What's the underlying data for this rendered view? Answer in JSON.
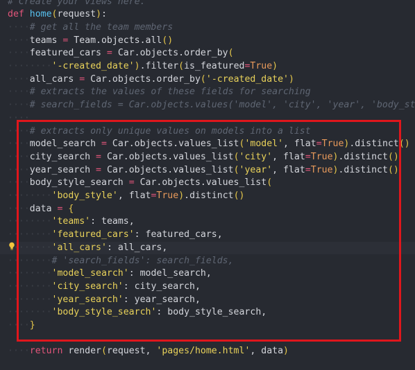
{
  "colors": {
    "background": "#272a31",
    "highlight_box": "#e0161c",
    "comment": "#5f6673",
    "keyword": "#e2557a",
    "function": "#58c2f0",
    "string": "#e9d25a",
    "bool": "#e89a5b",
    "paren": "#e5c64a",
    "text": "#d4d6dc"
  },
  "icons": {
    "gutter_hint": "lightbulb-icon"
  },
  "code": {
    "lines": [
      {
        "tokens": [
          {
            "t": "comment",
            "v": "# Create your views here."
          }
        ]
      },
      {
        "tokens": [
          {
            "t": "keyword",
            "v": "def"
          },
          {
            "t": "ident",
            "v": " "
          },
          {
            "t": "func",
            "v": "home"
          },
          {
            "t": "paren",
            "v": "("
          },
          {
            "t": "ident",
            "v": "request"
          },
          {
            "t": "paren",
            "v": ")"
          },
          {
            "t": "punct",
            "v": ":"
          }
        ]
      },
      {
        "tokens": [
          {
            "t": "ws",
            "v": "····"
          },
          {
            "t": "comment",
            "v": "# get all the team members"
          }
        ]
      },
      {
        "tokens": [
          {
            "t": "ws",
            "v": "····"
          },
          {
            "t": "ident",
            "v": "teams "
          },
          {
            "t": "operator",
            "v": "="
          },
          {
            "t": "ident",
            "v": " Team.objects.all"
          },
          {
            "t": "paren",
            "v": "()"
          }
        ]
      },
      {
        "tokens": [
          {
            "t": "ws",
            "v": "····"
          },
          {
            "t": "ident",
            "v": "featured_cars "
          },
          {
            "t": "operator",
            "v": "="
          },
          {
            "t": "ident",
            "v": " Car.objects.order_by"
          },
          {
            "t": "paren",
            "v": "("
          }
        ]
      },
      {
        "tokens": [
          {
            "t": "ws",
            "v": "········"
          },
          {
            "t": "string",
            "v": "'-created_date'"
          },
          {
            "t": "paren",
            "v": ")"
          },
          {
            "t": "ident",
            "v": ".filter"
          },
          {
            "t": "paren",
            "v": "("
          },
          {
            "t": "param",
            "v": "is_featured"
          },
          {
            "t": "operator",
            "v": "="
          },
          {
            "t": "bool",
            "v": "True"
          },
          {
            "t": "paren",
            "v": ")"
          }
        ]
      },
      {
        "tokens": [
          {
            "t": "ws",
            "v": "····"
          },
          {
            "t": "ident",
            "v": "all_cars "
          },
          {
            "t": "operator",
            "v": "="
          },
          {
            "t": "ident",
            "v": " Car.objects.order_by"
          },
          {
            "t": "paren",
            "v": "("
          },
          {
            "t": "string",
            "v": "'-created_date'"
          },
          {
            "t": "paren",
            "v": ")"
          }
        ]
      },
      {
        "tokens": [
          {
            "t": "ws",
            "v": "····"
          },
          {
            "t": "comment",
            "v": "# extracts the values of these fields for searching"
          }
        ]
      },
      {
        "tokens": [
          {
            "t": "ws",
            "v": "····"
          },
          {
            "t": "comment",
            "v": "# search_fields = Car.objects.values('model', 'city', 'year', 'body_style'"
          }
        ]
      },
      {
        "tokens": [
          {
            "t": "ws",
            "v": "····"
          }
        ]
      },
      {
        "tokens": [
          {
            "t": "ws",
            "v": "····"
          },
          {
            "t": "comment",
            "v": "# extracts only unique values on models into a list"
          }
        ]
      },
      {
        "tokens": [
          {
            "t": "ws",
            "v": "····"
          },
          {
            "t": "ident",
            "v": "model_search "
          },
          {
            "t": "operator",
            "v": "="
          },
          {
            "t": "ident",
            "v": " Car.objects.values_list"
          },
          {
            "t": "paren",
            "v": "("
          },
          {
            "t": "string",
            "v": "'model'"
          },
          {
            "t": "punct",
            "v": ", "
          },
          {
            "t": "param",
            "v": "flat"
          },
          {
            "t": "operator",
            "v": "="
          },
          {
            "t": "bool",
            "v": "True"
          },
          {
            "t": "paren",
            "v": ")"
          },
          {
            "t": "ident",
            "v": ".distinct"
          },
          {
            "t": "paren",
            "v": "()"
          }
        ]
      },
      {
        "tokens": [
          {
            "t": "ws",
            "v": "····"
          },
          {
            "t": "ident",
            "v": "city_search "
          },
          {
            "t": "operator",
            "v": "="
          },
          {
            "t": "ident",
            "v": " Car.objects.values_list"
          },
          {
            "t": "paren",
            "v": "("
          },
          {
            "t": "string",
            "v": "'city'"
          },
          {
            "t": "punct",
            "v": ", "
          },
          {
            "t": "param",
            "v": "flat"
          },
          {
            "t": "operator",
            "v": "="
          },
          {
            "t": "bool",
            "v": "True"
          },
          {
            "t": "paren",
            "v": ")"
          },
          {
            "t": "ident",
            "v": ".distinct"
          },
          {
            "t": "paren",
            "v": "()"
          }
        ]
      },
      {
        "tokens": [
          {
            "t": "ws",
            "v": "····"
          },
          {
            "t": "ident",
            "v": "year_search "
          },
          {
            "t": "operator",
            "v": "="
          },
          {
            "t": "ident",
            "v": " Car.objects.values_list"
          },
          {
            "t": "paren",
            "v": "("
          },
          {
            "t": "string",
            "v": "'year'"
          },
          {
            "t": "punct",
            "v": ", "
          },
          {
            "t": "param",
            "v": "flat"
          },
          {
            "t": "operator",
            "v": "="
          },
          {
            "t": "bool",
            "v": "True"
          },
          {
            "t": "paren",
            "v": ")"
          },
          {
            "t": "ident",
            "v": ".distinct"
          },
          {
            "t": "paren",
            "v": "()"
          }
        ]
      },
      {
        "tokens": [
          {
            "t": "ws",
            "v": "····"
          },
          {
            "t": "ident",
            "v": "body_style_search "
          },
          {
            "t": "operator",
            "v": "="
          },
          {
            "t": "ident",
            "v": " Car.objects.values_list"
          },
          {
            "t": "paren",
            "v": "("
          }
        ]
      },
      {
        "tokens": [
          {
            "t": "ws",
            "v": "········"
          },
          {
            "t": "string",
            "v": "'body_style'"
          },
          {
            "t": "punct",
            "v": ", "
          },
          {
            "t": "param",
            "v": "flat"
          },
          {
            "t": "operator",
            "v": "="
          },
          {
            "t": "bool",
            "v": "True"
          },
          {
            "t": "paren",
            "v": ")"
          },
          {
            "t": "ident",
            "v": ".distinct"
          },
          {
            "t": "paren",
            "v": "()"
          }
        ]
      },
      {
        "tokens": [
          {
            "t": "ws",
            "v": "····"
          },
          {
            "t": "ident",
            "v": "data "
          },
          {
            "t": "operator",
            "v": "="
          },
          {
            "t": "ident",
            "v": " "
          },
          {
            "t": "brace",
            "v": "{"
          }
        ]
      },
      {
        "tokens": [
          {
            "t": "ws",
            "v": "········"
          },
          {
            "t": "string",
            "v": "'teams'"
          },
          {
            "t": "punct",
            "v": ": "
          },
          {
            "t": "ident",
            "v": "teams,"
          }
        ]
      },
      {
        "tokens": [
          {
            "t": "ws",
            "v": "········"
          },
          {
            "t": "string",
            "v": "'featured_cars'"
          },
          {
            "t": "punct",
            "v": ": "
          },
          {
            "t": "ident",
            "v": "featured_cars,"
          }
        ]
      },
      {
        "current": true,
        "tokens": [
          {
            "t": "ws",
            "v": "········"
          },
          {
            "t": "string",
            "v": "'all_cars'"
          },
          {
            "t": "punct",
            "v": ": "
          },
          {
            "t": "ident",
            "v": "all_cars,"
          }
        ]
      },
      {
        "tokens": [
          {
            "t": "ws",
            "v": "········"
          },
          {
            "t": "comment",
            "v": "# 'search_fields': search_fields,"
          }
        ]
      },
      {
        "tokens": [
          {
            "t": "ws",
            "v": "········"
          },
          {
            "t": "string",
            "v": "'model_search'"
          },
          {
            "t": "punct",
            "v": ": "
          },
          {
            "t": "ident",
            "v": "model_search,"
          }
        ]
      },
      {
        "tokens": [
          {
            "t": "ws",
            "v": "········"
          },
          {
            "t": "string",
            "v": "'city_search'"
          },
          {
            "t": "punct",
            "v": ": "
          },
          {
            "t": "ident",
            "v": "city_search,"
          }
        ]
      },
      {
        "tokens": [
          {
            "t": "ws",
            "v": "········"
          },
          {
            "t": "string",
            "v": "'year_search'"
          },
          {
            "t": "punct",
            "v": ": "
          },
          {
            "t": "ident",
            "v": "year_search,"
          }
        ]
      },
      {
        "tokens": [
          {
            "t": "ws",
            "v": "········"
          },
          {
            "t": "string",
            "v": "'body_style_search'"
          },
          {
            "t": "punct",
            "v": ": "
          },
          {
            "t": "ident",
            "v": "body_style_search,"
          }
        ]
      },
      {
        "tokens": [
          {
            "t": "ws",
            "v": "····"
          },
          {
            "t": "brace",
            "v": "}"
          }
        ]
      },
      {
        "tokens": []
      },
      {
        "tokens": [
          {
            "t": "ws",
            "v": "····"
          },
          {
            "t": "keyword",
            "v": "return"
          },
          {
            "t": "ident",
            "v": " render"
          },
          {
            "t": "paren",
            "v": "("
          },
          {
            "t": "ident",
            "v": "request, "
          },
          {
            "t": "string",
            "v": "'pages/home.html'"
          },
          {
            "t": "ident",
            "v": ", data"
          },
          {
            "t": "paren",
            "v": ")"
          }
        ]
      }
    ]
  }
}
